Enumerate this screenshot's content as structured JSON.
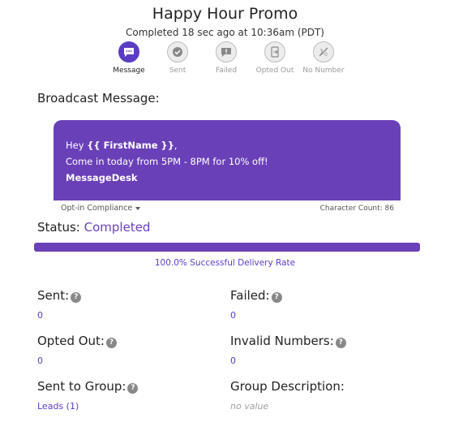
{
  "header": {
    "title": "Happy Hour Promo",
    "subtitle": "Completed 18 sec ago at 10:36am (PDT)"
  },
  "steps": [
    {
      "label": "Message",
      "icon": "message-icon",
      "active": true
    },
    {
      "label": "Sent",
      "icon": "check-icon",
      "active": false
    },
    {
      "label": "Failed",
      "icon": "failed-icon",
      "active": false
    },
    {
      "label": "Opted Out",
      "icon": "opted-out-icon",
      "active": false
    },
    {
      "label": "No Number",
      "icon": "no-number-icon",
      "active": false
    }
  ],
  "broadcast": {
    "section_title": "Broadcast Message:",
    "line1_prefix": "Hey ",
    "line1_token": "{{ FirstName }}",
    "line1_suffix": ",",
    "line2": "Come in today from 5PM - 8PM for 10% off!",
    "line3": "MessageDesk",
    "compliance_label": "Opt-in Compliance",
    "char_count": "Character Count: 86"
  },
  "status": {
    "label": "Status:",
    "value": "Completed",
    "progress_fraction": 1.0,
    "rate_text": "100.0% Successful Delivery Rate"
  },
  "stats": {
    "sent_label": "Sent:",
    "sent_value": "0",
    "failed_label": "Failed:",
    "failed_value": "0",
    "opted_out_label": "Opted Out:",
    "opted_out_value": "0",
    "invalid_label": "Invalid Numbers:",
    "invalid_value": "0",
    "group_label": "Sent to Group:",
    "group_value": "Leads (1)",
    "desc_label": "Group Description:",
    "desc_value": "no value",
    "help_glyph": "?"
  },
  "colors": {
    "accent": "#6a40b8",
    "accent_dark": "#5b3cc4",
    "muted": "#a0a0a0"
  }
}
